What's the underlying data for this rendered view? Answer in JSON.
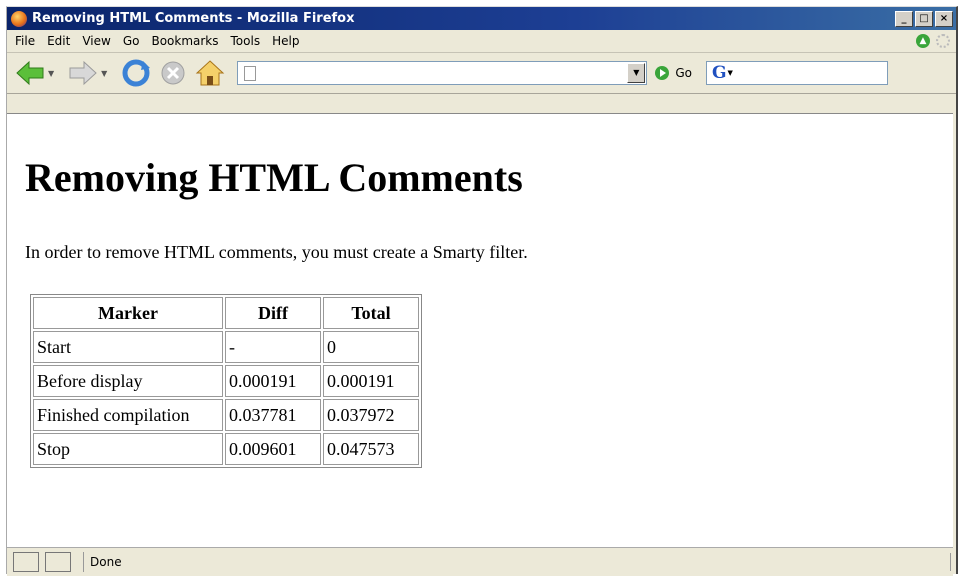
{
  "window": {
    "title": "Removing HTML Comments - Mozilla Firefox"
  },
  "menu": [
    {
      "label": "File"
    },
    {
      "label": "Edit"
    },
    {
      "label": "View"
    },
    {
      "label": "Go"
    },
    {
      "label": "Bookmarks"
    },
    {
      "label": "Tools"
    },
    {
      "label": "Help"
    }
  ],
  "toolbar": {
    "url_value": "",
    "go_label": "Go",
    "search_value": ""
  },
  "page": {
    "heading": "Removing HTML Comments",
    "intro": "In order to remove HTML comments, you must create a Smarty filter.",
    "table": {
      "headers": [
        "Marker",
        "Diff",
        "Total"
      ],
      "rows": [
        [
          "Start",
          "-",
          "0"
        ],
        [
          "Before display",
          "0.000191",
          "0.000191"
        ],
        [
          "Finished compilation",
          "0.037781",
          "0.037972"
        ],
        [
          "Stop",
          "0.009601",
          "0.047573"
        ]
      ]
    }
  },
  "status": {
    "text": "Done"
  }
}
